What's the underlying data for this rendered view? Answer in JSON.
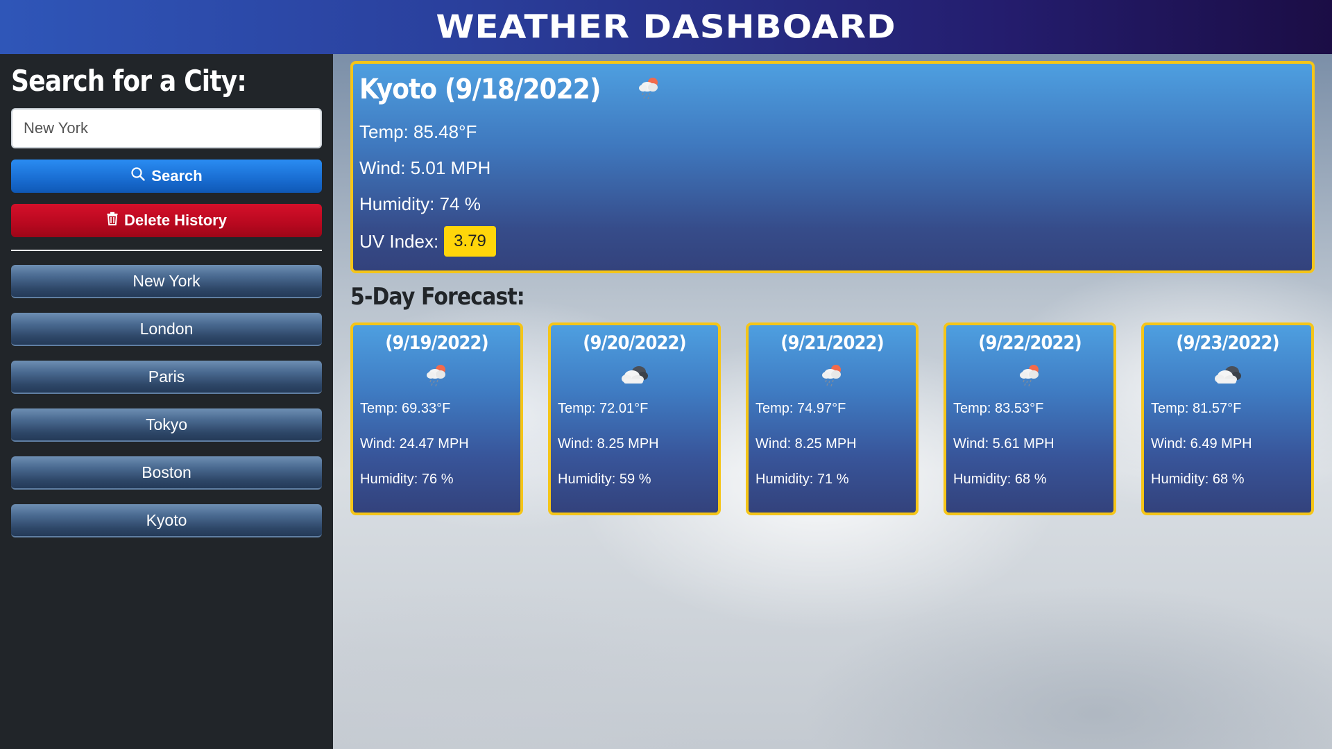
{
  "header": {
    "title": "WEATHER DASHBOARD"
  },
  "sidebar": {
    "heading": "Search for a City:",
    "search_value": "New York",
    "search_button": "Search",
    "delete_button": "Delete History",
    "history": [
      "New York",
      "London",
      "Paris",
      "Tokyo",
      "Boston",
      "Kyoto"
    ]
  },
  "current": {
    "title": "Kyoto (9/18/2022)",
    "icon": "rain-cloud-sun-icon",
    "temp": "Temp: 85.48°F",
    "wind": "Wind: 5.01 MPH",
    "humidity": "Humidity: 74 %",
    "uv_label": "UV Index:",
    "uv_value": "3.79",
    "uv_color": "#ffd60a"
  },
  "forecast": {
    "title": "5-Day Forecast:",
    "days": [
      {
        "date": "(9/19/2022)",
        "icon": "rain-cloud-sun-icon",
        "temp": "Temp: 69.33°F",
        "wind": "Wind: 24.47 MPH",
        "humidity": "Humidity: 76 %"
      },
      {
        "date": "(9/20/2022)",
        "icon": "cloud-icon",
        "temp": "Temp: 72.01°F",
        "wind": "Wind: 8.25 MPH",
        "humidity": "Humidity: 59 %"
      },
      {
        "date": "(9/21/2022)",
        "icon": "rain-cloud-sun-icon",
        "temp": "Temp: 74.97°F",
        "wind": "Wind: 8.25 MPH",
        "humidity": "Humidity: 71 %"
      },
      {
        "date": "(9/22/2022)",
        "icon": "rain-cloud-sun-icon",
        "temp": "Temp: 83.53°F",
        "wind": "Wind: 5.61 MPH",
        "humidity": "Humidity: 68 %"
      },
      {
        "date": "(9/23/2022)",
        "icon": "cloud-icon",
        "temp": "Temp: 81.57°F",
        "wind": "Wind: 6.49 MPH",
        "humidity": "Humidity: 68 %"
      }
    ]
  },
  "colors": {
    "accent_border": "#f5c518",
    "search": "#1a6fd4",
    "delete": "#b8081f"
  }
}
